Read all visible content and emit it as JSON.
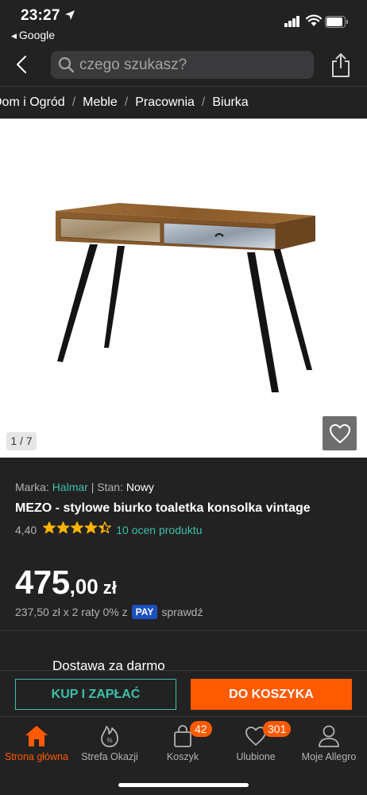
{
  "status_bar": {
    "time": "23:27",
    "back_app": "Google"
  },
  "search": {
    "placeholder": "czego szukasz?"
  },
  "breadcrumb": {
    "items": [
      "Dom i Ogród",
      "Meble",
      "Pracownia",
      "Biurka"
    ],
    "separator": "/"
  },
  "gallery": {
    "counter": "1 / 7"
  },
  "product": {
    "brand_label": "Marka:",
    "brand": "Halmar",
    "condition_label": "Stan:",
    "condition": "Nowy",
    "title": "MEZO - stylowe biurko toaletka konsolka vintage",
    "rating": "4,40",
    "rating_value": 4.4,
    "rating_max": 5,
    "reviews_link": "10 ocen produktu",
    "price_integer": "475",
    "price_decimal": ",00",
    "currency": "zł",
    "installments_text": "237,50 zł x 2 raty 0% z",
    "pay_badge": "PAY",
    "check_link": "sprawdź",
    "delivery": "Dostawa za darmo"
  },
  "actions": {
    "buy_now": "KUP I ZAPŁAĆ",
    "add_to_cart": "DO KOSZYKA"
  },
  "tab_bar": {
    "items": [
      {
        "label": "Strona główna",
        "icon": "home-icon",
        "active": true
      },
      {
        "label": "Strefa Okazji",
        "icon": "deals-icon",
        "active": false
      },
      {
        "label": "Koszyk",
        "icon": "cart-icon",
        "badge": "42",
        "active": false
      },
      {
        "label": "Ulubione",
        "icon": "heart-icon",
        "badge": "301",
        "active": false
      },
      {
        "label": "Moje Allegro",
        "icon": "user-icon",
        "active": false
      }
    ]
  },
  "colors": {
    "background": "#222222",
    "accent_orange": "#ff5a00",
    "accent_teal": "#3dbfa8",
    "star": "#ffb400",
    "pay_blue": "#1d4fbf"
  }
}
